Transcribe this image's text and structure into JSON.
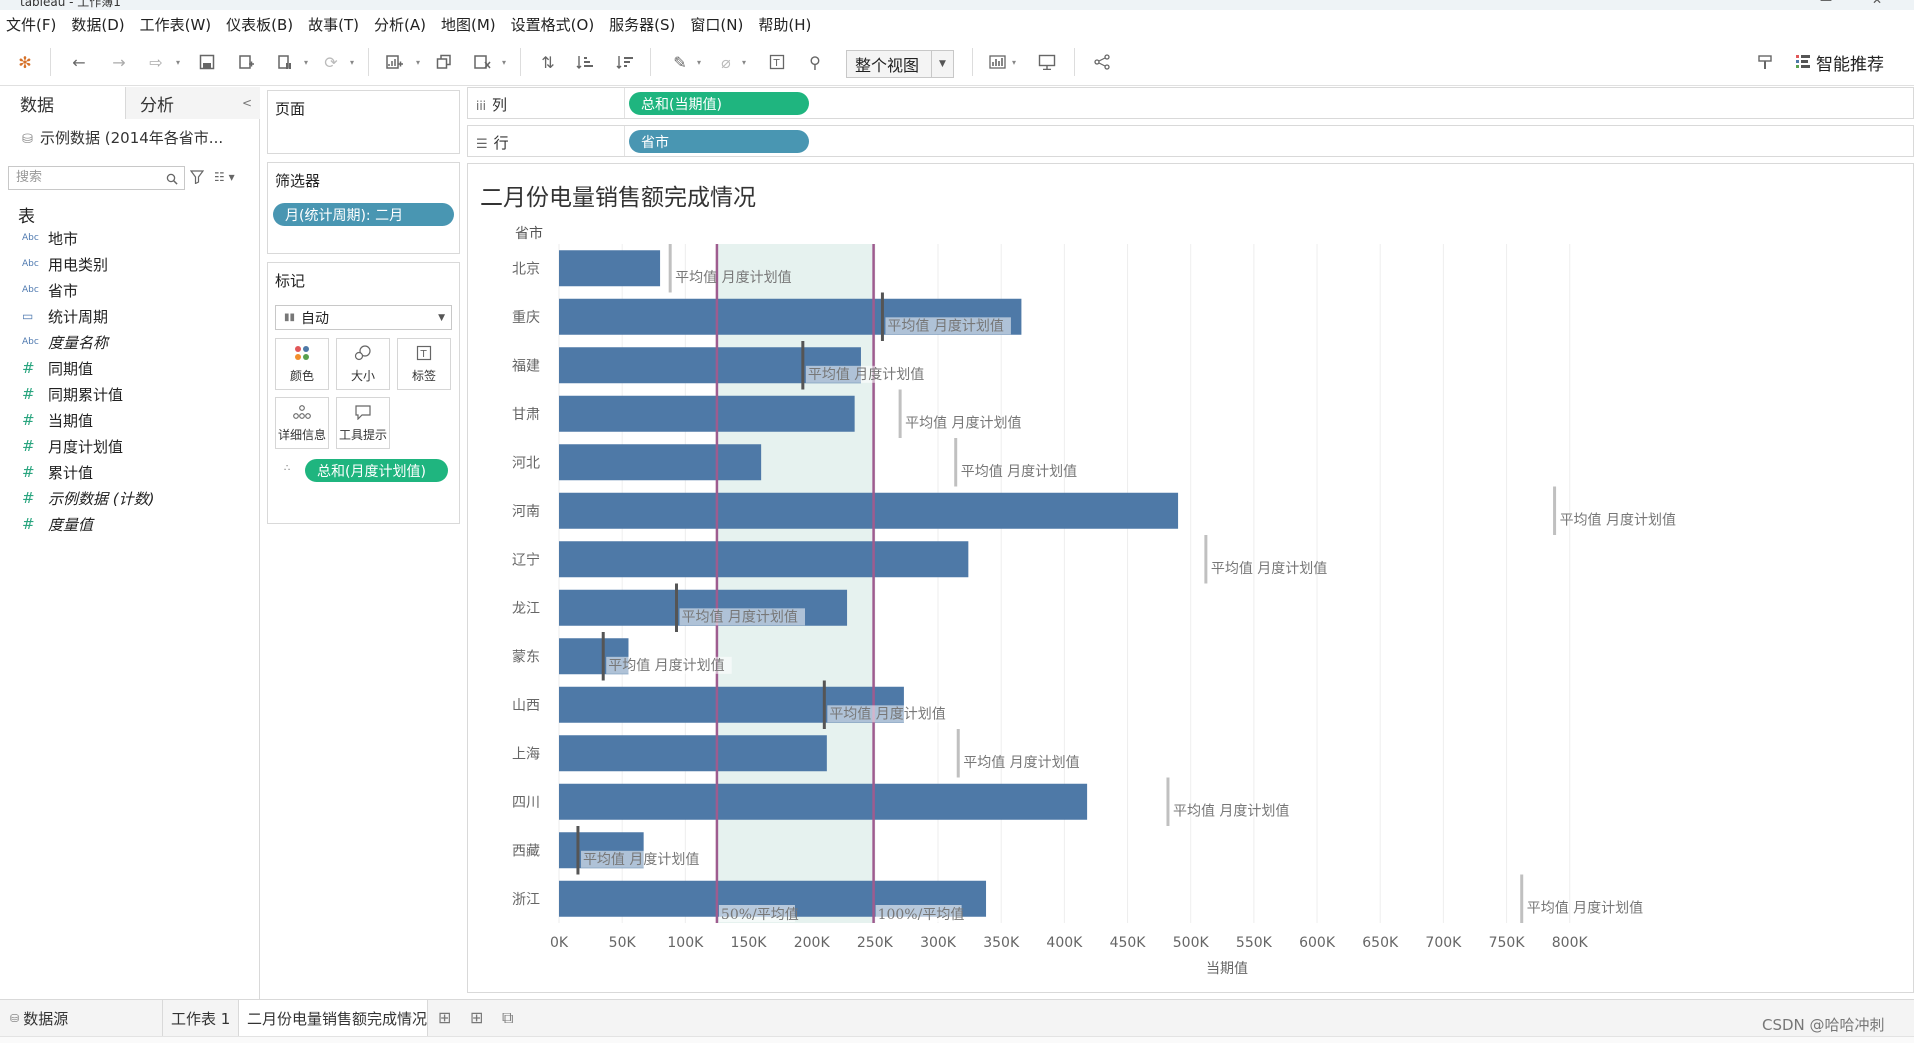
{
  "window": {
    "title": "tableau - 工作簿1"
  },
  "menu": [
    "文件(F)",
    "数据(D)",
    "工作表(W)",
    "仪表板(B)",
    "故事(T)",
    "分析(A)",
    "地图(M)",
    "设置格式(O)",
    "服务器(S)",
    "窗口(N)",
    "帮助(H)"
  ],
  "toolbar": {
    "view_mode": "整个视图",
    "smart_recommend": "智能推荐",
    "icons": [
      "tableau-logo-icon",
      "undo-icon",
      "redo-icon",
      "forward-icon",
      "save-icon",
      "new-datasource-icon",
      "pause-icon",
      "refresh-icon",
      "new-sheet-icon",
      "duplicate-icon",
      "clear-icon",
      "swap-icon",
      "sort-asc-icon",
      "sort-desc-icon",
      "highlight-icon",
      "group-icon",
      "label-icon",
      "pin-icon",
      "chart-size-icon",
      "presentation-icon",
      "share-icon",
      "show-me-icon"
    ]
  },
  "data_pane": {
    "tab_data": "数据",
    "tab_analysis": "分析",
    "source": "示例数据 (2014年各省市...",
    "search_placeholder": "搜索",
    "tables_heading": "表",
    "fields": [
      {
        "type": "Abc",
        "name": "地市",
        "italic": false
      },
      {
        "type": "Abc",
        "name": "用电类别",
        "italic": false
      },
      {
        "type": "Abc",
        "name": "省市",
        "italic": false
      },
      {
        "type": "date",
        "name": "统计周期",
        "italic": false
      },
      {
        "type": "Abc",
        "name": "度量名称",
        "italic": true
      },
      {
        "type": "#",
        "name": "同期值",
        "italic": false
      },
      {
        "type": "#",
        "name": "同期累计值",
        "italic": false
      },
      {
        "type": "#",
        "name": "当期值",
        "italic": false
      },
      {
        "type": "#",
        "name": "月度计划值",
        "italic": false
      },
      {
        "type": "#",
        "name": "累计值",
        "italic": false
      },
      {
        "type": "#",
        "name": "示例数据 (计数)",
        "italic": true
      },
      {
        "type": "#",
        "name": "度量值",
        "italic": true
      }
    ]
  },
  "pages": {
    "title": "页面"
  },
  "filters": {
    "title": "筛选器",
    "pill": "月(统计周期): 二月"
  },
  "marks": {
    "title": "标记",
    "type": "自动",
    "buttons": [
      "颜色",
      "大小",
      "标签",
      "详细信息",
      "工具提示"
    ],
    "detail_pill": "总和(月度计划值)"
  },
  "shelves": {
    "columns_label": "列",
    "columns_pill": "总和(当期值)",
    "rows_label": "行",
    "rows_pill": "省市"
  },
  "chart_data": {
    "type": "bar",
    "title": "二月份电量销售额完成情况",
    "orientation": "horizontal",
    "row_header": "省市",
    "xlabel": "当期值",
    "xlim": [
      0,
      820000
    ],
    "xticks": [
      "0K",
      "50K",
      "100K",
      "150K",
      "200K",
      "250K",
      "300K",
      "350K",
      "400K",
      "450K",
      "500K",
      "550K",
      "600K",
      "650K",
      "700K",
      "750K",
      "800K"
    ],
    "categories": [
      "北京",
      "重庆",
      "福建",
      "甘肃",
      "河北",
      "河南",
      "辽宁",
      "龙江",
      "蒙东",
      "山西",
      "上海",
      "四川",
      "西藏",
      "浙江"
    ],
    "series": [
      {
        "name": "当期值",
        "values": [
          80000,
          366000,
          239000,
          234000,
          160000,
          490000,
          324000,
          228000,
          55000,
          273000,
          212000,
          418000,
          67000,
          338000
        ]
      }
    ],
    "reference_lines": [
      {
        "label": "平均值 月度计划值",
        "per_category": true,
        "values": [
          88000,
          256000,
          193000,
          270000,
          314000,
          788000,
          512000,
          93000,
          35000,
          210000,
          316000,
          482000,
          15000,
          762000
        ]
      }
    ],
    "reference_band": {
      "from": 125000,
      "to": 249000,
      "from_label": "50%/平均值",
      "to_label": "100%/平均值"
    },
    "colors": {
      "bar": "#4e79a7",
      "band": "#e6f2ef",
      "band_line": "#9e5c8f",
      "ref_line": "#c0c0c0",
      "ref_line_dark": "#555555"
    },
    "grid": true
  },
  "bottom": {
    "datasource_tab": "数据源",
    "sheet1_tab": "工作表 1",
    "active_tab": "二月份电量销售额完成情况",
    "watermark": "CSDN @哈哈冲刺"
  }
}
